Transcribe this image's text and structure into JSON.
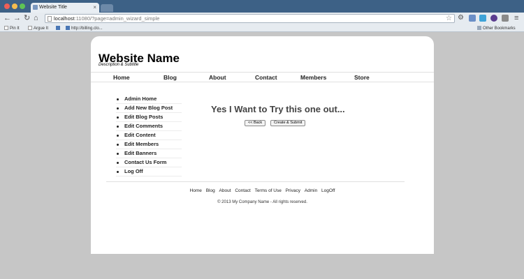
{
  "browser": {
    "tab_title": "Website Title",
    "url_host": "localhost",
    "url_path": ":11080/?page=admin_wizard_simple",
    "bookmarks": [
      "Pin It",
      "Argue It",
      "http://billing.clo..."
    ],
    "other_bookmarks": "Other Bookmarks"
  },
  "site": {
    "name": "Website Name",
    "subtitle": "Description & Subtitle"
  },
  "main_nav": [
    "Home",
    "Blog",
    "About",
    "Contact",
    "Members",
    "Store"
  ],
  "admin_menu": [
    "Admin Home",
    "Add New Blog Post",
    "Edit Blog Posts",
    "Edit Comments",
    "Edit Content",
    "Edit Members",
    "Edit Banners",
    "Contact Us Form",
    "Log Off"
  ],
  "content": {
    "heading": "Yes I Want to Try this one out...",
    "back_label": "<< Back",
    "submit_label": "Create & Submit"
  },
  "footer": {
    "links": [
      "Home",
      "Blog",
      "About",
      "Contact",
      "Terms of Use",
      "Privacy",
      "Admin",
      "LogOff"
    ],
    "copyright": "© 2013 My Company Name - All rights reserved."
  },
  "colors": {
    "tabbar": "#3d6186",
    "page_background": "#c6c6c6",
    "card": "#ffffff",
    "heading_text": "#444444"
  },
  "icons": [
    "close-window-icon",
    "minimize-icon",
    "zoom-icon",
    "back-icon",
    "forward-icon",
    "reload-icon",
    "home-icon",
    "bookmark-star-icon",
    "settings-icon",
    "menu-icon"
  ]
}
